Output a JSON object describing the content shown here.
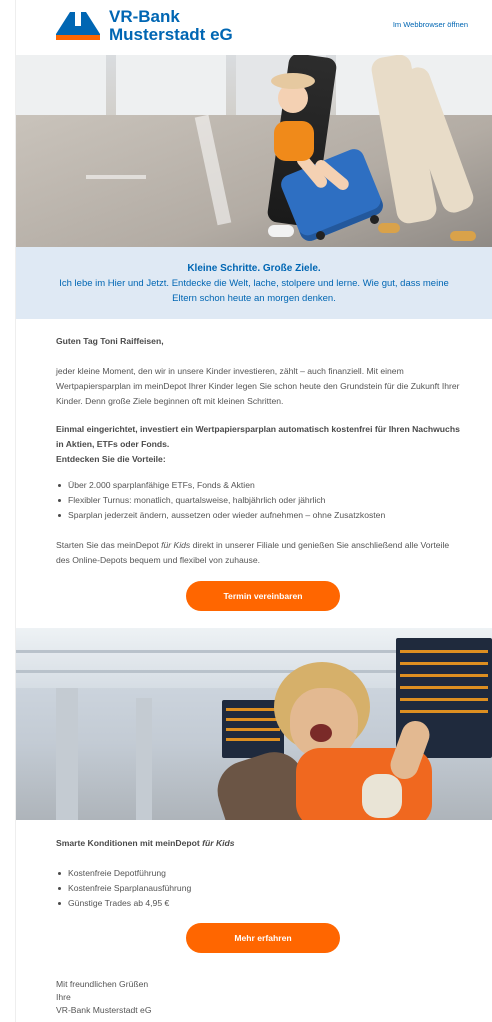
{
  "header": {
    "bank_name_line1": "VR-Bank",
    "bank_name_line2": "Musterstadt eG",
    "webbrowser_link": "Im Webbrowser öffnen"
  },
  "band": {
    "title": "Kleine Schritte. Große Ziele.",
    "text": "Ich lebe im Hier und Jetzt. Entdecke die Welt, lache, stolpere und lerne. Wie gut, dass meine Eltern schon heute an morgen denken."
  },
  "body": {
    "greeting": "Guten Tag Toni Raiffeisen,",
    "intro": "jeder kleine Moment, den wir in unsere Kinder investieren, zählt – auch finanziell. Mit einem Wertpapiersparplan im meinDepot Ihrer Kinder legen Sie schon heute den Grundstein für die Zukunft Ihrer Kinder. Denn große Ziele beginnen oft mit kleinen Schritten.",
    "bold_1": "Einmal eingerichtet, investiert ein Wertpapiersparplan automatisch kostenfrei für Ihren Nachwuchs in Aktien, ETFs oder Fonds.",
    "bold_2": "Entdecken Sie die Vorteile:",
    "bullets": [
      "Über 2.000 sparplanfähige ETFs, Fonds & Aktien",
      "Flexibler Turnus: monatlich, quartalsweise, halbjährlich oder jährlich",
      "Sparplan jederzeit ändern, aussetzen oder wieder aufnehmen – ohne Zusatzkosten"
    ],
    "closing_pre": "Starten Sie das meinDepot ",
    "closing_em": "für Kids",
    "closing_post": " direkt in unserer Filiale und genießen Sie anschließend alle Vorteile des Online-Depots bequem und flexibel von zuhause.",
    "button_appointment": "Termin vereinbaren"
  },
  "conditions": {
    "title_pre": "Smarte Konditionen mit meinDepot ",
    "title_em": "für Kids",
    "bullets": [
      "Kostenfreie Depotführung",
      "Kostenfreie Sparplanausführung",
      "Günstige Trades ab 4,95 €"
    ],
    "button_more": "Mehr erfahren"
  },
  "signature": {
    "line1": "Mit freundlichen Grüßen",
    "line2": "Ihre",
    "line3": "VR-Bank Musterstadt eG"
  },
  "colors": {
    "brand_blue": "#0066b3",
    "brand_orange": "#ff6600",
    "band_background": "#dfe9f4"
  }
}
